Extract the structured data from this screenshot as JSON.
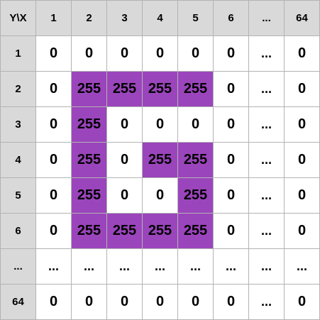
{
  "corner_label": "Y\\X",
  "column_headers": [
    "1",
    "2",
    "3",
    "4",
    "5",
    "6",
    "...",
    "64"
  ],
  "rows": [
    {
      "label": "1",
      "cells": [
        "0",
        "0",
        "0",
        "0",
        "0",
        "0",
        "...",
        "0"
      ]
    },
    {
      "label": "2",
      "cells": [
        "0",
        "255",
        "255",
        "255",
        "255",
        "0",
        "...",
        "0"
      ]
    },
    {
      "label": "3",
      "cells": [
        "0",
        "255",
        "0",
        "0",
        "0",
        "0",
        "...",
        "0"
      ]
    },
    {
      "label": "4",
      "cells": [
        "0",
        "255",
        "0",
        "255",
        "255",
        "0",
        "...",
        "0"
      ]
    },
    {
      "label": "5",
      "cells": [
        "0",
        "255",
        "0",
        "0",
        "255",
        "0",
        "...",
        "0"
      ]
    },
    {
      "label": "6",
      "cells": [
        "0",
        "255",
        "255",
        "255",
        "255",
        "0",
        "...",
        "0"
      ]
    },
    {
      "label": "...",
      "cells": [
        "...",
        "...",
        "...",
        "...",
        "...",
        "...",
        "...",
        "..."
      ]
    },
    {
      "label": "64",
      "cells": [
        "0",
        "0",
        "0",
        "0",
        "0",
        "0",
        "...",
        "0"
      ]
    }
  ],
  "colors": {
    "header_bg": "#d9d9d9",
    "cell_bg": "#ffffff",
    "highlight_bg": "#9b45bc",
    "grid_line": "#b3b3b3",
    "text": "#000000"
  },
  "highlight_value": "255"
}
